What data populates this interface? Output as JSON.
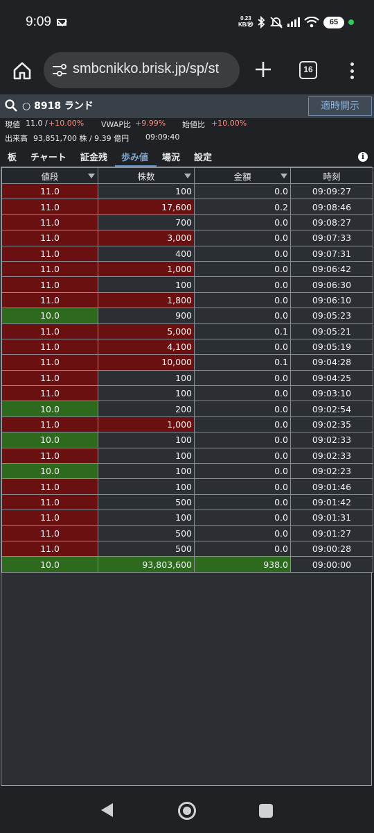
{
  "status_bar": {
    "time": "9:09",
    "speed_value": "0.23",
    "speed_unit": "KB/秒",
    "battery": "65",
    "icons": [
      "mail-icon",
      "bluetooth-icon",
      "mute-icon",
      "signal-icon",
      "wifi-icon",
      "battery-icon"
    ]
  },
  "browser": {
    "url": "smbcnikko.brisk.jp/sp/st",
    "tab_count": "16"
  },
  "header": {
    "stock": "○ 8918 ランド",
    "open_button": "適時開示"
  },
  "info": {
    "price_label": "現値",
    "price_value": "11.0 /",
    "price_change": "+10.00%",
    "vwap_label": "VWAP比",
    "vwap_value": "+9.99%",
    "open_label": "始値比",
    "open_value": "+10.00%",
    "volume_label": "出来高",
    "volume_value": "93,851,700 株 / 9.39 億円",
    "time": "09:09:40"
  },
  "tabs": [
    "板",
    "チャート",
    "証金残",
    "歩み値",
    "場況",
    "設定"
  ],
  "active_tab": "歩み値",
  "columns": [
    "値段",
    "株数",
    "金額",
    "時刻"
  ],
  "rows": [
    {
      "price": "11.0",
      "qty": "100",
      "amount": "0.0",
      "time": "09:09:27",
      "pc": "up",
      "qc": "base"
    },
    {
      "price": "11.0",
      "qty": "17,600",
      "amount": "0.2",
      "time": "09:08:46",
      "pc": "up",
      "qc": "up"
    },
    {
      "price": "11.0",
      "qty": "700",
      "amount": "0.0",
      "time": "09:08:27",
      "pc": "up",
      "qc": "base"
    },
    {
      "price": "11.0",
      "qty": "3,000",
      "amount": "0.0",
      "time": "09:07:33",
      "pc": "up",
      "qc": "up"
    },
    {
      "price": "11.0",
      "qty": "400",
      "amount": "0.0",
      "time": "09:07:31",
      "pc": "up",
      "qc": "base"
    },
    {
      "price": "11.0",
      "qty": "1,000",
      "amount": "0.0",
      "time": "09:06:42",
      "pc": "up",
      "qc": "up"
    },
    {
      "price": "11.0",
      "qty": "100",
      "amount": "0.0",
      "time": "09:06:30",
      "pc": "up",
      "qc": "base"
    },
    {
      "price": "11.0",
      "qty": "1,800",
      "amount": "0.0",
      "time": "09:06:10",
      "pc": "up",
      "qc": "up"
    },
    {
      "price": "10.0",
      "qty": "900",
      "amount": "0.0",
      "time": "09:05:23",
      "pc": "dn",
      "qc": "base"
    },
    {
      "price": "11.0",
      "qty": "5,000",
      "amount": "0.1",
      "time": "09:05:21",
      "pc": "up",
      "qc": "up"
    },
    {
      "price": "11.0",
      "qty": "4,100",
      "amount": "0.0",
      "time": "09:05:19",
      "pc": "up",
      "qc": "up"
    },
    {
      "price": "11.0",
      "qty": "10,000",
      "amount": "0.1",
      "time": "09:04:28",
      "pc": "up",
      "qc": "up"
    },
    {
      "price": "11.0",
      "qty": "100",
      "amount": "0.0",
      "time": "09:04:25",
      "pc": "up",
      "qc": "base"
    },
    {
      "price": "11.0",
      "qty": "100",
      "amount": "0.0",
      "time": "09:03:10",
      "pc": "up",
      "qc": "base"
    },
    {
      "price": "10.0",
      "qty": "200",
      "amount": "0.0",
      "time": "09:02:54",
      "pc": "dn",
      "qc": "base"
    },
    {
      "price": "11.0",
      "qty": "1,000",
      "amount": "0.0",
      "time": "09:02:35",
      "pc": "up",
      "qc": "up"
    },
    {
      "price": "10.0",
      "qty": "100",
      "amount": "0.0",
      "time": "09:02:33",
      "pc": "dn",
      "qc": "base"
    },
    {
      "price": "11.0",
      "qty": "100",
      "amount": "0.0",
      "time": "09:02:33",
      "pc": "up",
      "qc": "base"
    },
    {
      "price": "10.0",
      "qty": "100",
      "amount": "0.0",
      "time": "09:02:23",
      "pc": "dn",
      "qc": "base"
    },
    {
      "price": "11.0",
      "qty": "100",
      "amount": "0.0",
      "time": "09:01:46",
      "pc": "up",
      "qc": "base"
    },
    {
      "price": "11.0",
      "qty": "500",
      "amount": "0.0",
      "time": "09:01:42",
      "pc": "up",
      "qc": "base"
    },
    {
      "price": "11.0",
      "qty": "100",
      "amount": "0.0",
      "time": "09:01:31",
      "pc": "up",
      "qc": "base"
    },
    {
      "price": "11.0",
      "qty": "500",
      "amount": "0.0",
      "time": "09:01:27",
      "pc": "up",
      "qc": "base"
    },
    {
      "price": "11.0",
      "qty": "500",
      "amount": "0.0",
      "time": "09:00:28",
      "pc": "up",
      "qc": "base"
    },
    {
      "price": "10.0",
      "qty": "93,803,600",
      "amount": "938.0",
      "time": "09:00:00",
      "pc": "dn",
      "qc": "dn",
      "ac": "dn"
    }
  ],
  "colors": {
    "up": "#6b1010",
    "down": "#2e6a1e",
    "accent": "#5b8fc8",
    "positive_text": "#ff8a80"
  }
}
